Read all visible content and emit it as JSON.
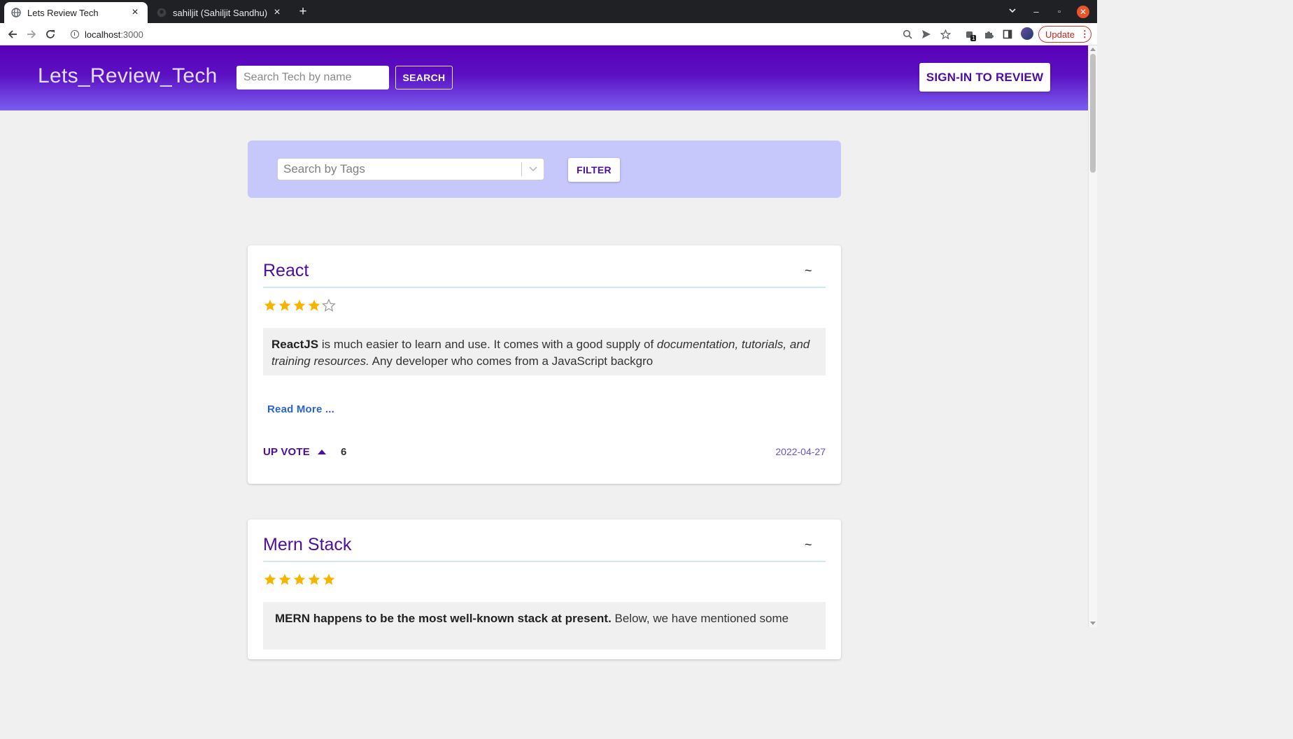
{
  "browser": {
    "tabs": [
      {
        "title": "Lets Review Tech",
        "active": true
      },
      {
        "title": "sahiljit (Sahiljit Sandhu)",
        "active": false
      }
    ],
    "url_host": "localhost",
    "url_port": ":3000",
    "update_label": "Update",
    "extension_badge": "1"
  },
  "header": {
    "brand": "Lets_Review_Tech",
    "search_placeholder": "Search Tech by name",
    "search_button": "SEARCH",
    "signin_button": "SIGN-IN TO REVIEW"
  },
  "filter": {
    "tags_placeholder": "Search by Tags",
    "filter_button": "FILTER"
  },
  "colors": {
    "brand_purple": "#4b0ea0",
    "header_gradient_top": "#5a00b8",
    "header_gradient_bottom": "#7a5ef0",
    "filter_panel": "#c6c7fb",
    "star": "#f6b400"
  },
  "reviews": [
    {
      "title": "React",
      "toggle": "~",
      "rating": 4,
      "rating_max": 5,
      "excerpt_bold": "ReactJS",
      "excerpt_text1": " is much easier to learn and use. It comes with a good supply of ",
      "excerpt_italic": "documentation, tutorials, and training resources.",
      "excerpt_text2": " Any developer who comes from a JavaScript backgro",
      "read_more": "Read More ...",
      "upvote_label": "UP VOTE",
      "votes": "6",
      "date": "2022-04-27"
    },
    {
      "title": "Mern Stack",
      "toggle": "~",
      "rating": 5,
      "rating_max": 5,
      "excerpt_bold": "MERN happens to be the most well-known stack at present.",
      "excerpt_text1": " Below, we have mentioned some"
    }
  ]
}
